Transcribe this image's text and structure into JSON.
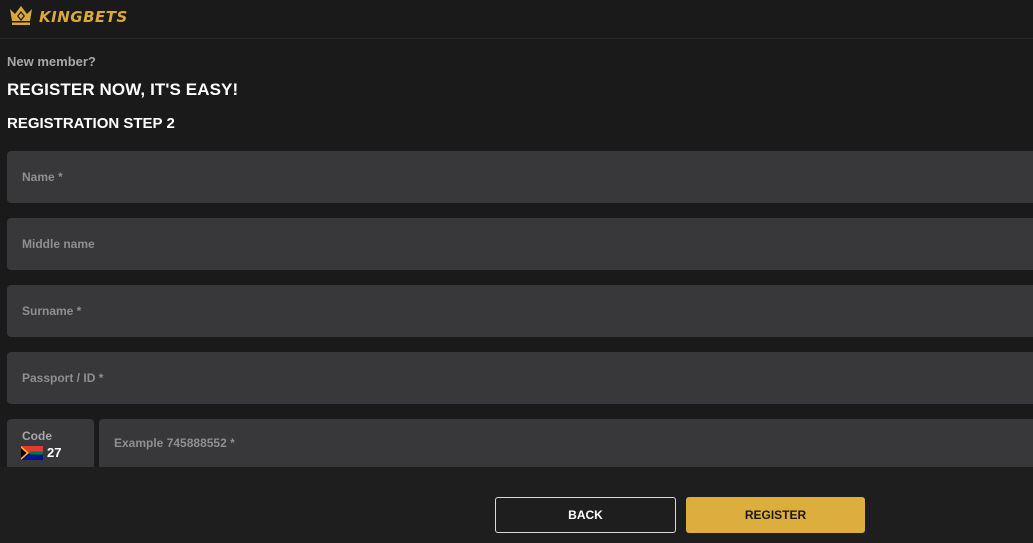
{
  "header": {
    "logo_text": "KINGBETS",
    "logo_icon": "crown-icon"
  },
  "intro": {
    "new_member": "New member?",
    "headline": "REGISTER NOW, IT'S EASY!",
    "step_title": "REGISTRATION STEP 2"
  },
  "form": {
    "name": {
      "placeholder": "Name *",
      "value": ""
    },
    "middle_name": {
      "placeholder": "Middle name",
      "value": ""
    },
    "surname": {
      "placeholder": "Surname *",
      "value": ""
    },
    "passport": {
      "placeholder": "Passport / ID *",
      "value": ""
    },
    "code": {
      "label": "Code",
      "value": "27",
      "flag_icon": "south-africa-flag-icon"
    },
    "phone": {
      "placeholder": "Example 745888552 *",
      "value": ""
    }
  },
  "actions": {
    "back_label": "BACK",
    "register_label": "REGISTER"
  },
  "colors": {
    "accent": "#dbae3d",
    "background": "#1b1a1b",
    "field": "#38373a"
  }
}
